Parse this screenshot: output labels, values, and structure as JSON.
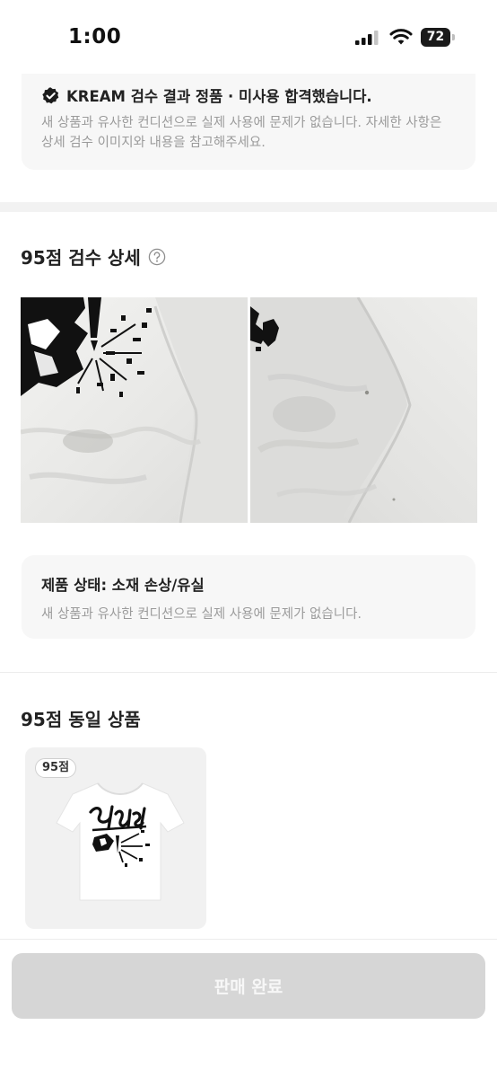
{
  "status_bar": {
    "time": "1:00",
    "battery": "72"
  },
  "inspection_notice": {
    "title": "KREAM 검수 결과 정품 · 미사용 합격했습니다.",
    "description": "새 상품과 유사한 컨디션으로 실제 사용에 문제가 없습니다. 자세한 사항은 상세 검수 이미지와 내용을 참고해주세요."
  },
  "inspection_detail": {
    "title": "95점 검수 상세",
    "condition_title": "제품 상태: 소재 손상/유실",
    "condition_description": "새 상품과 유사한 컨디션으로 실제 사용에 문제가 없습니다."
  },
  "same_grade": {
    "title": "95점 동일 상품",
    "products": [
      {
        "grade": "95점"
      }
    ]
  },
  "footer": {
    "button_label": "판매 완료"
  },
  "colors": {
    "notice_bg": "#f7f7f7",
    "disabled_button": "#d6d6d6",
    "muted_text": "#9b9b9b"
  }
}
